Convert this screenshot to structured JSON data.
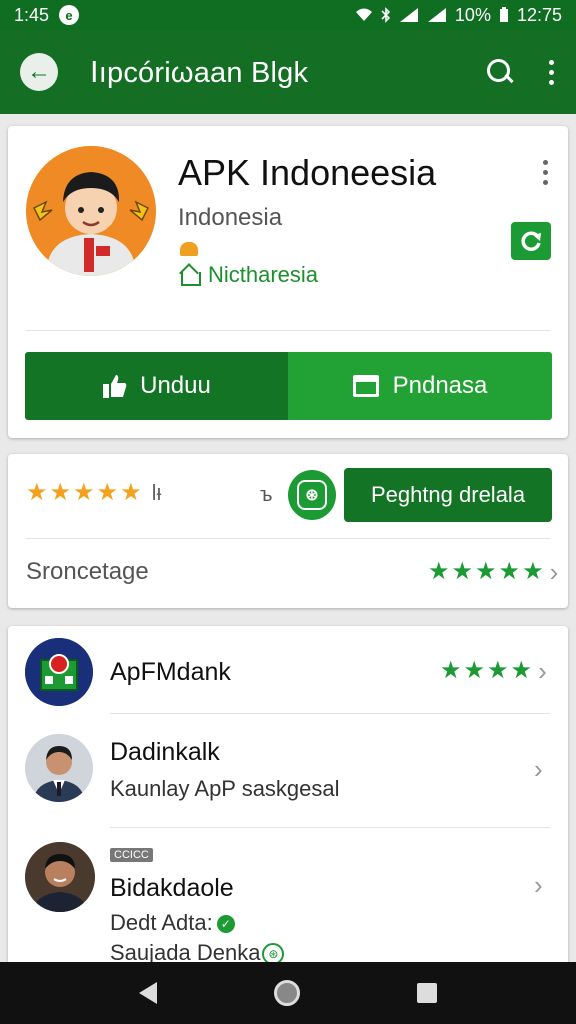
{
  "status_bar": {
    "time_left": "1:45",
    "notif_glyph": "e",
    "battery": "10%",
    "time_right": "12:75"
  },
  "app_bar": {
    "back_glyph": "←",
    "title": "Ⅰıpcóriωaan Blgk"
  },
  "app_card": {
    "name": "APK Indoneesia",
    "subtitle": "Indonesia",
    "location_label": "Nictharesia",
    "download_label": "Unduu",
    "pending_label": "Pndnasa",
    "accent_color": "#137425"
  },
  "rating_card": {
    "rating_stars": 5,
    "rating_count": "lᵼ",
    "separator_glyph": "ъ",
    "badge_glyph": "⊛",
    "report_label": "Peghtng drelala",
    "storage_label": "Sroncetage",
    "storage_stars": 5
  },
  "list": [
    {
      "title": "ApFMdank",
      "stars": 4
    },
    {
      "title": "Dadinkalk",
      "subtitle": "Kaunlay ApP saskgesal"
    },
    {
      "tag": "CCICC",
      "title": "Bidakdaole",
      "line1": "Dedt Adta:",
      "line2": "Saujada Denka"
    }
  ],
  "icons": [
    "back-arrow-icon",
    "search-icon",
    "more-vert-icon",
    "refresh-icon",
    "house-icon",
    "thumbs-up-icon",
    "card-icon",
    "star-icon",
    "shield-badge-icon",
    "chevron-right-icon",
    "check-circle-icon"
  ]
}
